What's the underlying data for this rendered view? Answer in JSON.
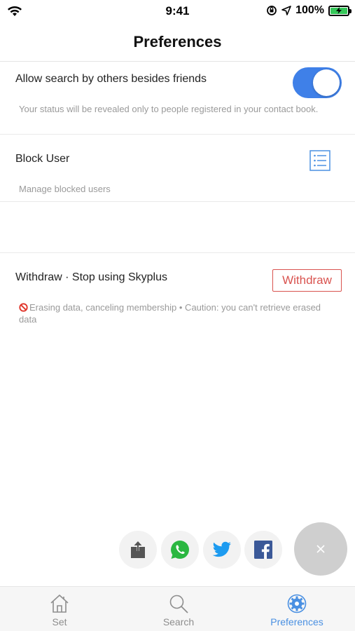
{
  "status_bar": {
    "time": "9:41",
    "battery": "100%"
  },
  "header": {
    "title": "Preferences"
  },
  "settings": {
    "search_by_others": {
      "title": "Allow search by others besides friends",
      "description": "Your status will be revealed only to people registered in your contact book.",
      "enabled": true
    },
    "block_user": {
      "title": "Block User",
      "description": "Manage blocked users",
      "icon": "list-icon"
    },
    "withdraw": {
      "title": "Withdraw · Stop using Skyplus",
      "button_label": "Withdraw",
      "description": "Erasing data, canceling membership • Caution: you can't retrieve erased data",
      "accent": "#d9534f"
    }
  },
  "share": {
    "items": [
      "export-icon",
      "whatsapp-icon",
      "twitter-icon",
      "facebook-icon"
    ],
    "close_label": "×"
  },
  "tab_bar": {
    "tabs": [
      {
        "label": "Set",
        "icon": "home-icon",
        "active": false
      },
      {
        "label": "Search",
        "icon": "search-icon",
        "active": false
      },
      {
        "label": "Preferences",
        "icon": "gear-icon",
        "active": true
      }
    ],
    "active_color": "#4a90e2"
  }
}
